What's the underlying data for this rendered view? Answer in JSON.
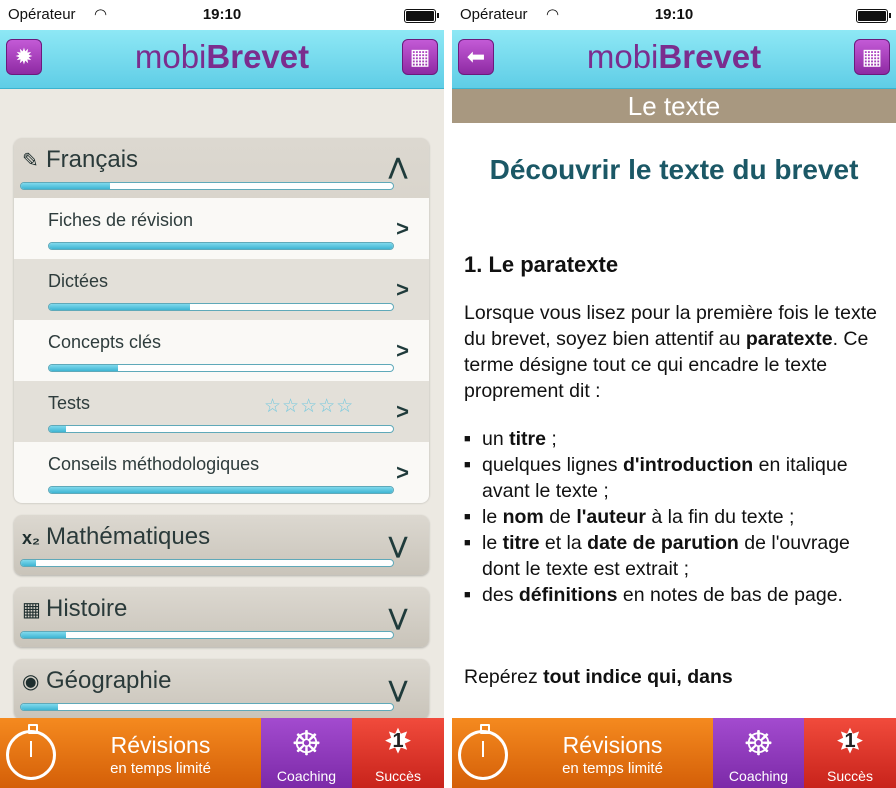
{
  "status": {
    "carrier": "Opérateur",
    "time": "19:10"
  },
  "app": {
    "logo_left": "mobi",
    "logo_right": "Brevet"
  },
  "left": {
    "accordions": [
      {
        "title": "Français",
        "icon": "pencil-icon",
        "progress": 0.24,
        "expanded": true,
        "items": [
          {
            "label": "Fiches de révision",
            "progress": 1.0
          },
          {
            "label": "Dictées",
            "progress": 0.41
          },
          {
            "label": "Concepts clés",
            "progress": 0.2
          },
          {
            "label": "Tests",
            "progress": 0.05,
            "stars": "☆☆☆☆☆"
          },
          {
            "label": "Conseils méthodologiques",
            "progress": 1.0
          }
        ]
      },
      {
        "title": "Mathématiques",
        "icon_text": "x₂",
        "progress": 0.04
      },
      {
        "title": "Histoire",
        "icon": "calendar-icon",
        "progress": 0.12
      },
      {
        "title": "Géographie",
        "icon": "globe-icon",
        "progress": 0.1
      }
    ]
  },
  "tabbar": {
    "revisions_line1": "Révisions",
    "revisions_line2": "en temps limité",
    "coaching": "Coaching",
    "succes": "Succès",
    "succes_count": "1"
  },
  "right": {
    "section_title": "Le texte",
    "heading": "Découvrir le texte du brevet",
    "subheading": "1. Le paratexte",
    "para1_a": "Lorsque vous lisez pour la première fois le texte du brevet, soyez bien attentif au ",
    "para1_b": "paratexte",
    "para1_c": ". Ce terme désigne tout ce qui encadre le texte proprement dit :",
    "list": [
      {
        "a": "un ",
        "b": "titre",
        "c": " ;"
      },
      {
        "a": "quelques lignes ",
        "b": "d'introduction",
        "c": " en italique avant le texte ;"
      },
      {
        "a": "le ",
        "b": "nom",
        "c": " de ",
        "d": "l'auteur",
        "e": " à la fin du texte ;"
      },
      {
        "a": "le ",
        "b": "titre",
        "c": " et la ",
        "d": "date de parution",
        "e": " de l'ouvrage dont le texte est extrait ;"
      },
      {
        "a": "des ",
        "b": "définitions",
        "c": " en notes de bas de page."
      }
    ],
    "last_a": "Repérez ",
    "last_b": "tout indice qui, dans"
  }
}
